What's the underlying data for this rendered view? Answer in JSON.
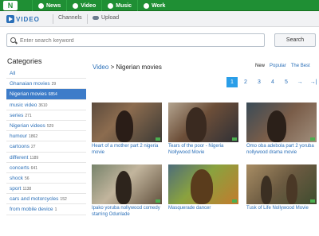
{
  "nav": {
    "logo": "N",
    "items": [
      {
        "label": "News",
        "icon": "home-icon"
      },
      {
        "label": "Video",
        "icon": "video-icon"
      },
      {
        "label": "Music",
        "icon": "music-icon"
      },
      {
        "label": "Work",
        "icon": "work-icon"
      }
    ]
  },
  "subnav": {
    "brand": "VIDEO",
    "channels": "Channels",
    "upload": "Upload"
  },
  "search": {
    "placeholder": "Enter search keyword",
    "value": "",
    "button": "Search"
  },
  "categories": {
    "heading": "Categories",
    "items": [
      {
        "label": "All",
        "count": ""
      },
      {
        "label": "Ghanaian movies",
        "count": "29"
      },
      {
        "label": "Nigerian movies",
        "count": "6854",
        "active": true
      },
      {
        "label": "music video",
        "count": "3610"
      },
      {
        "label": "series",
        "count": "271"
      },
      {
        "label": "Nigerian videos",
        "count": "529"
      },
      {
        "label": "humour",
        "count": "1862"
      },
      {
        "label": "cartoons",
        "count": "27"
      },
      {
        "label": "different",
        "count": "1189"
      },
      {
        "label": "concerts",
        "count": "641"
      },
      {
        "label": "shock",
        "count": "56"
      },
      {
        "label": "sport",
        "count": "1138"
      },
      {
        "label": "cars and motorcycles",
        "count": "152"
      },
      {
        "label": "from mobile device",
        "count": "1"
      }
    ]
  },
  "breadcrumb": {
    "root": "Video",
    "separator": ">",
    "current": "Nigerian movies"
  },
  "sort": {
    "options": [
      "New",
      "Popular",
      "The Best"
    ],
    "selected": "New"
  },
  "pagination": {
    "pages": [
      "1",
      "2",
      "3",
      "4",
      "5"
    ],
    "current": "1",
    "next": "→",
    "last": "→|"
  },
  "videos": [
    {
      "title": "Heart of a mother part 2 nigeria movie"
    },
    {
      "title": "Tears of the poor - Nigeria Nollywood Movie"
    },
    {
      "title": "Omo oba adebola part 2 yoruba nollywood drama movie"
    },
    {
      "title": "Ipako yoruba nollywood comedy starring Odunlade"
    },
    {
      "title": "Masquerade dancer"
    },
    {
      "title": "Tusk of Life Nollywood Movie"
    }
  ],
  "colors": {
    "topbar": "#1f8f34",
    "accent": "#2a6fb8",
    "active_category": "#3d7cc9",
    "current_page": "#2a9ee8"
  }
}
